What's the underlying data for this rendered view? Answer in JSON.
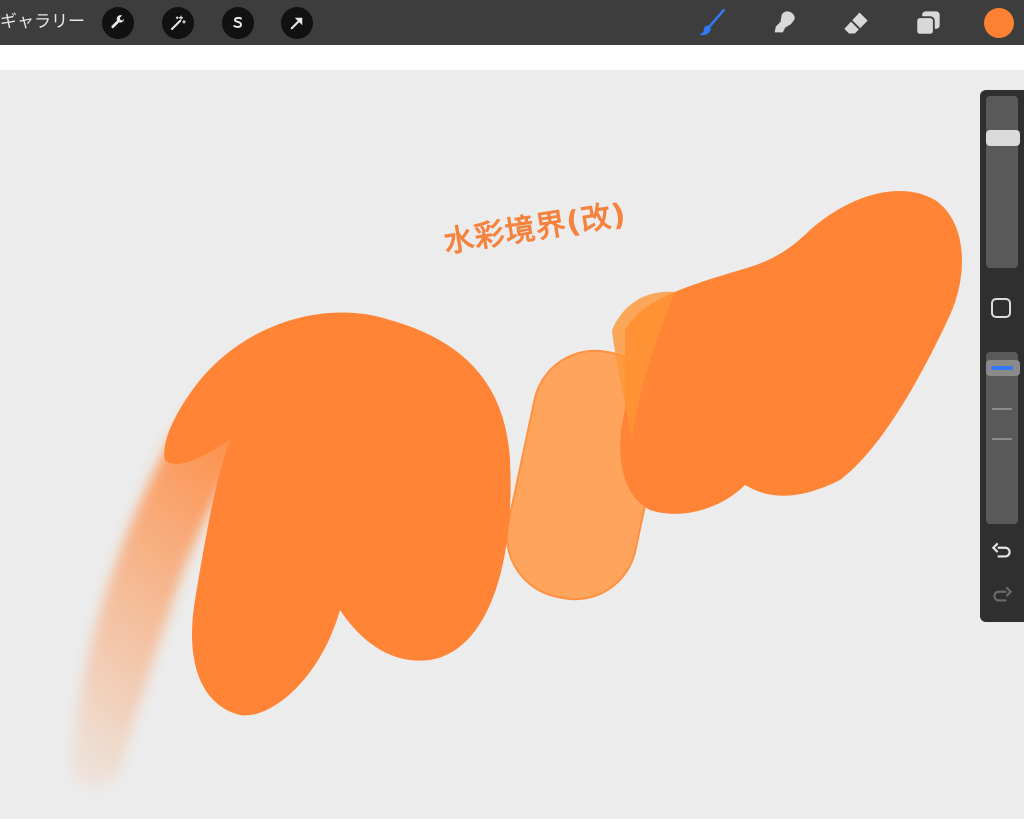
{
  "topbar": {
    "gallery_label": "ギャラリー",
    "left_tools": [
      {
        "icon": "wrench-icon",
        "name": "actions"
      },
      {
        "icon": "magic-wand-icon",
        "name": "adjustments"
      },
      {
        "icon": "selection-s-icon",
        "name": "selection"
      },
      {
        "icon": "arrow-cursor-icon",
        "name": "transform"
      }
    ],
    "right_tools": [
      {
        "icon": "brush-icon",
        "name": "paint",
        "active": true
      },
      {
        "icon": "smudge-finger-icon",
        "name": "smudge",
        "active": false
      },
      {
        "icon": "eraser-icon",
        "name": "erase",
        "active": false
      },
      {
        "icon": "layers-icon",
        "name": "layers",
        "active": false
      }
    ],
    "current_color": "#fd8133"
  },
  "canvas": {
    "title": "水彩境界(改)",
    "title_color": "#f5833d",
    "stroke_color": "#ff8436",
    "light_stroke_color": "#ffa45c"
  },
  "sidebar": {
    "brush_size_level": 0.78,
    "opacity_level": 0.95,
    "undo_icon": "undo-arrow-icon",
    "redo_icon": "redo-arrow-icon",
    "modify_icon": "square-modify-icon"
  },
  "colors": {
    "topbar_bg": "#3d3d3d",
    "canvas_bg": "#ececec",
    "accent_blue": "#2f7bf6"
  }
}
